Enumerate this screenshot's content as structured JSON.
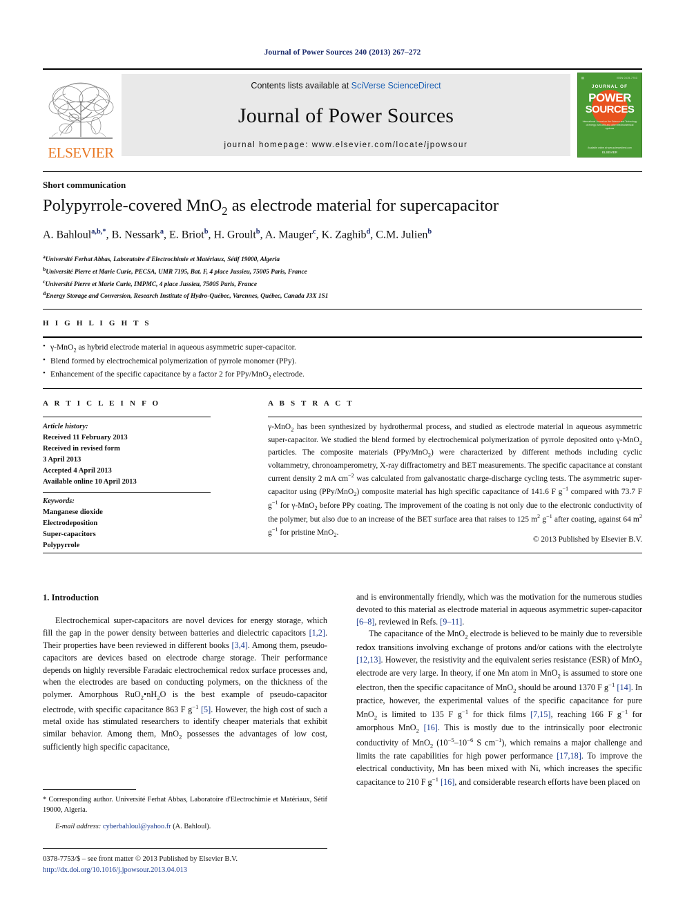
{
  "running_head": "Journal of Power Sources 240 (2013) 267–272",
  "masthead": {
    "contents_prefix": "Contents lists available at ",
    "sciencedirect": "SciVerse ScienceDirect",
    "journal_name": "Journal of Power Sources",
    "homepage": "journal homepage: www.elsevier.com/locate/jpowsour",
    "publisher_wordmark": "ELSEVIER",
    "publisher_logo_icon": "elsevier-tree-icon",
    "cover": {
      "top_label": "ISSN 0378-7753",
      "journal_of": "JOURNAL OF",
      "power": "POWER",
      "sources": "SOURCES",
      "subtitle": "International Journal on the Science and Technology of energy, fuel cells and other electrochemical systems",
      "foot": "Available online at www.sciencedirect.com",
      "elsevier": "ELSEVIER",
      "bg_color": "#4b9b35",
      "accent_color": "#e8521f"
    }
  },
  "doctype": "Short communication",
  "title_pre": "Polypyrrole-covered MnO",
  "title_sub": "2",
  "title_post": " as electrode material for supercapacitor",
  "authors": [
    {
      "name": "A. Bahloul",
      "sup": "a,b,*"
    },
    {
      "name": "B. Nessark",
      "sup": "a"
    },
    {
      "name": "E. Briot",
      "sup": "b"
    },
    {
      "name": "H. Groult",
      "sup": "b"
    },
    {
      "name": "A. Mauger",
      "sup": "c"
    },
    {
      "name": "K. Zaghib",
      "sup": "d"
    },
    {
      "name": "C.M. Julien",
      "sup": "b"
    }
  ],
  "affiliations": [
    {
      "sup": "a",
      "text": "Université Ferhat Abbas, Laboratoire d'Electrochimie et Matériaux, Sétif 19000, Algeria"
    },
    {
      "sup": "b",
      "text": "Université Pierre et Marie Curie, PECSA, UMR 7195, Bat. F, 4 place Jussieu, 75005 Paris, France"
    },
    {
      "sup": "c",
      "text": "Université Pierre et Marie Curie, IMPMC, 4 place Jussieu, 75005 Paris, France"
    },
    {
      "sup": "d",
      "text": "Energy Storage and Conversion, Research Institute of Hydro-Québec, Varennes, Québec, Canada J3X 1S1"
    }
  ],
  "highlights": {
    "label": "H I G H L I G H T S",
    "items": [
      "γ-MnO₂ as hybrid electrode material in aqueous asymmetric super-capacitor.",
      "Blend formed by electrochemical polymerization of pyrrole monomer (PPy).",
      "Enhancement of the specific capacitance by a factor 2 for PPy/MnO₂ electrode."
    ]
  },
  "article_info": {
    "label": "A R T I C L E    I N F O",
    "history_label": "Article history:",
    "history": [
      "Received 11 February 2013",
      "Received in revised form",
      "3 April 2013",
      "Accepted 4 April 2013",
      "Available online 10 April 2013"
    ],
    "keywords_label": "Keywords:",
    "keywords": [
      "Manganese dioxide",
      "Electrodeposition",
      "Super-capacitors",
      "Polypyrrole"
    ]
  },
  "abstract": {
    "label": "A B S T R A C T",
    "text": "γ-MnO₂ has been synthesized by hydrothermal process, and studied as electrode material in aqueous asymmetric super-capacitor. We studied the blend formed by electrochemical polymerization of pyrrole deposited onto γ-MnO₂ particles. The composite materials (PPy/MnO₂) were characterized by different methods including cyclic voltammetry, chronoamperometry, X-ray diffractometry and BET measurements. The specific capacitance at constant current density 2 mA cm⁻² was calculated from galvanostatic charge-discharge cycling tests. The asymmetric super-capacitor using (PPy/MnO₂) composite material has high specific capacitance of 141.6 F g⁻¹ compared with 73.7 F g⁻¹ for γ-MnO₂ before PPy coating. The improvement of the coating is not only due to the electronic conductivity of the polymer, but also due to an increase of the BET surface area that raises to 125 m² g⁻¹ after coating, against 64 m² g⁻¹ for pristine MnO₂.",
    "copyright": "© 2013 Published by Elsevier B.V."
  },
  "body": {
    "section_number_title": "1.  Introduction",
    "left_paragraph_1": "Electrochemical super-capacitors are novel devices for energy storage, which fill the gap in the power density between batteries and dielectric capacitors [1,2]. Their properties have been reviewed in different books [3,4]. Among them, pseudo-capacitors are devices based on electrode charge storage. Their performance depends on highly reversible Faradaic electrochemical redox surface processes and, when the electrodes are based on conducting polymers, on the thickness of the polymer. Amorphous RuO₂•nH₂O is the best example of pseudo-capacitor electrode, with specific capacitance 863 F g⁻¹ [5]. However, the high cost of such a metal oxide has stimulated researchers to identify cheaper materials that exhibit similar behavior. Among them, MnO₂ possesses the advantages of low cost, sufficiently high specific capacitance,",
    "right_paragraph_1": "and is environmentally friendly, which was the motivation for the numerous studies devoted to this material as electrode material in aqueous asymmetric super-capacitor [6–8], reviewed in Refs. [9–11].",
    "right_paragraph_2": "The capacitance of the MnO₂ electrode is believed to be mainly due to reversible redox transitions involving exchange of protons and/or cations with the electrolyte [12,13]. However, the resistivity and the equivalent series resistance (ESR) of MnO₂ electrode are very large. In theory, if one Mn atom in MnO₂ is assumed to store one electron, then the specific capacitance of MnO₂ should be around 1370 F g⁻¹ [14]. In practice, however, the experimental values of the specific capacitance for pure MnO₂ is limited to 135 F g⁻¹ for thick films [7,15], reaching 166 F g⁻¹ for amorphous MnO₂ [16]. This is mostly due to the intrinsically poor electronic conductivity of MnO₂ (10⁻⁵–10⁻⁶ S cm⁻¹), which remains a major challenge and limits the rate capabilities for high power performance [17,18]. To improve the electrical conductivity, Mn has been mixed with Ni, which increases the specific capacitance to 210 F g⁻¹ [16], and considerable research efforts have been placed on"
  },
  "footnotes": {
    "corresponding": "* Corresponding author. Université Ferhat Abbas, Laboratoire d'Electrochimie et Matériaux, Sétif 19000, Algeria.",
    "email_label": "E-mail address:",
    "email": "cyberbahloul@yahoo.fr",
    "email_suffix": " (A. Bahloul).",
    "issn_line": "0378-7753/$ – see front matter © 2013 Published by Elsevier B.V.",
    "doi_line": "http://dx.doi.org/10.1016/j.jpowsour.2013.04.013"
  }
}
